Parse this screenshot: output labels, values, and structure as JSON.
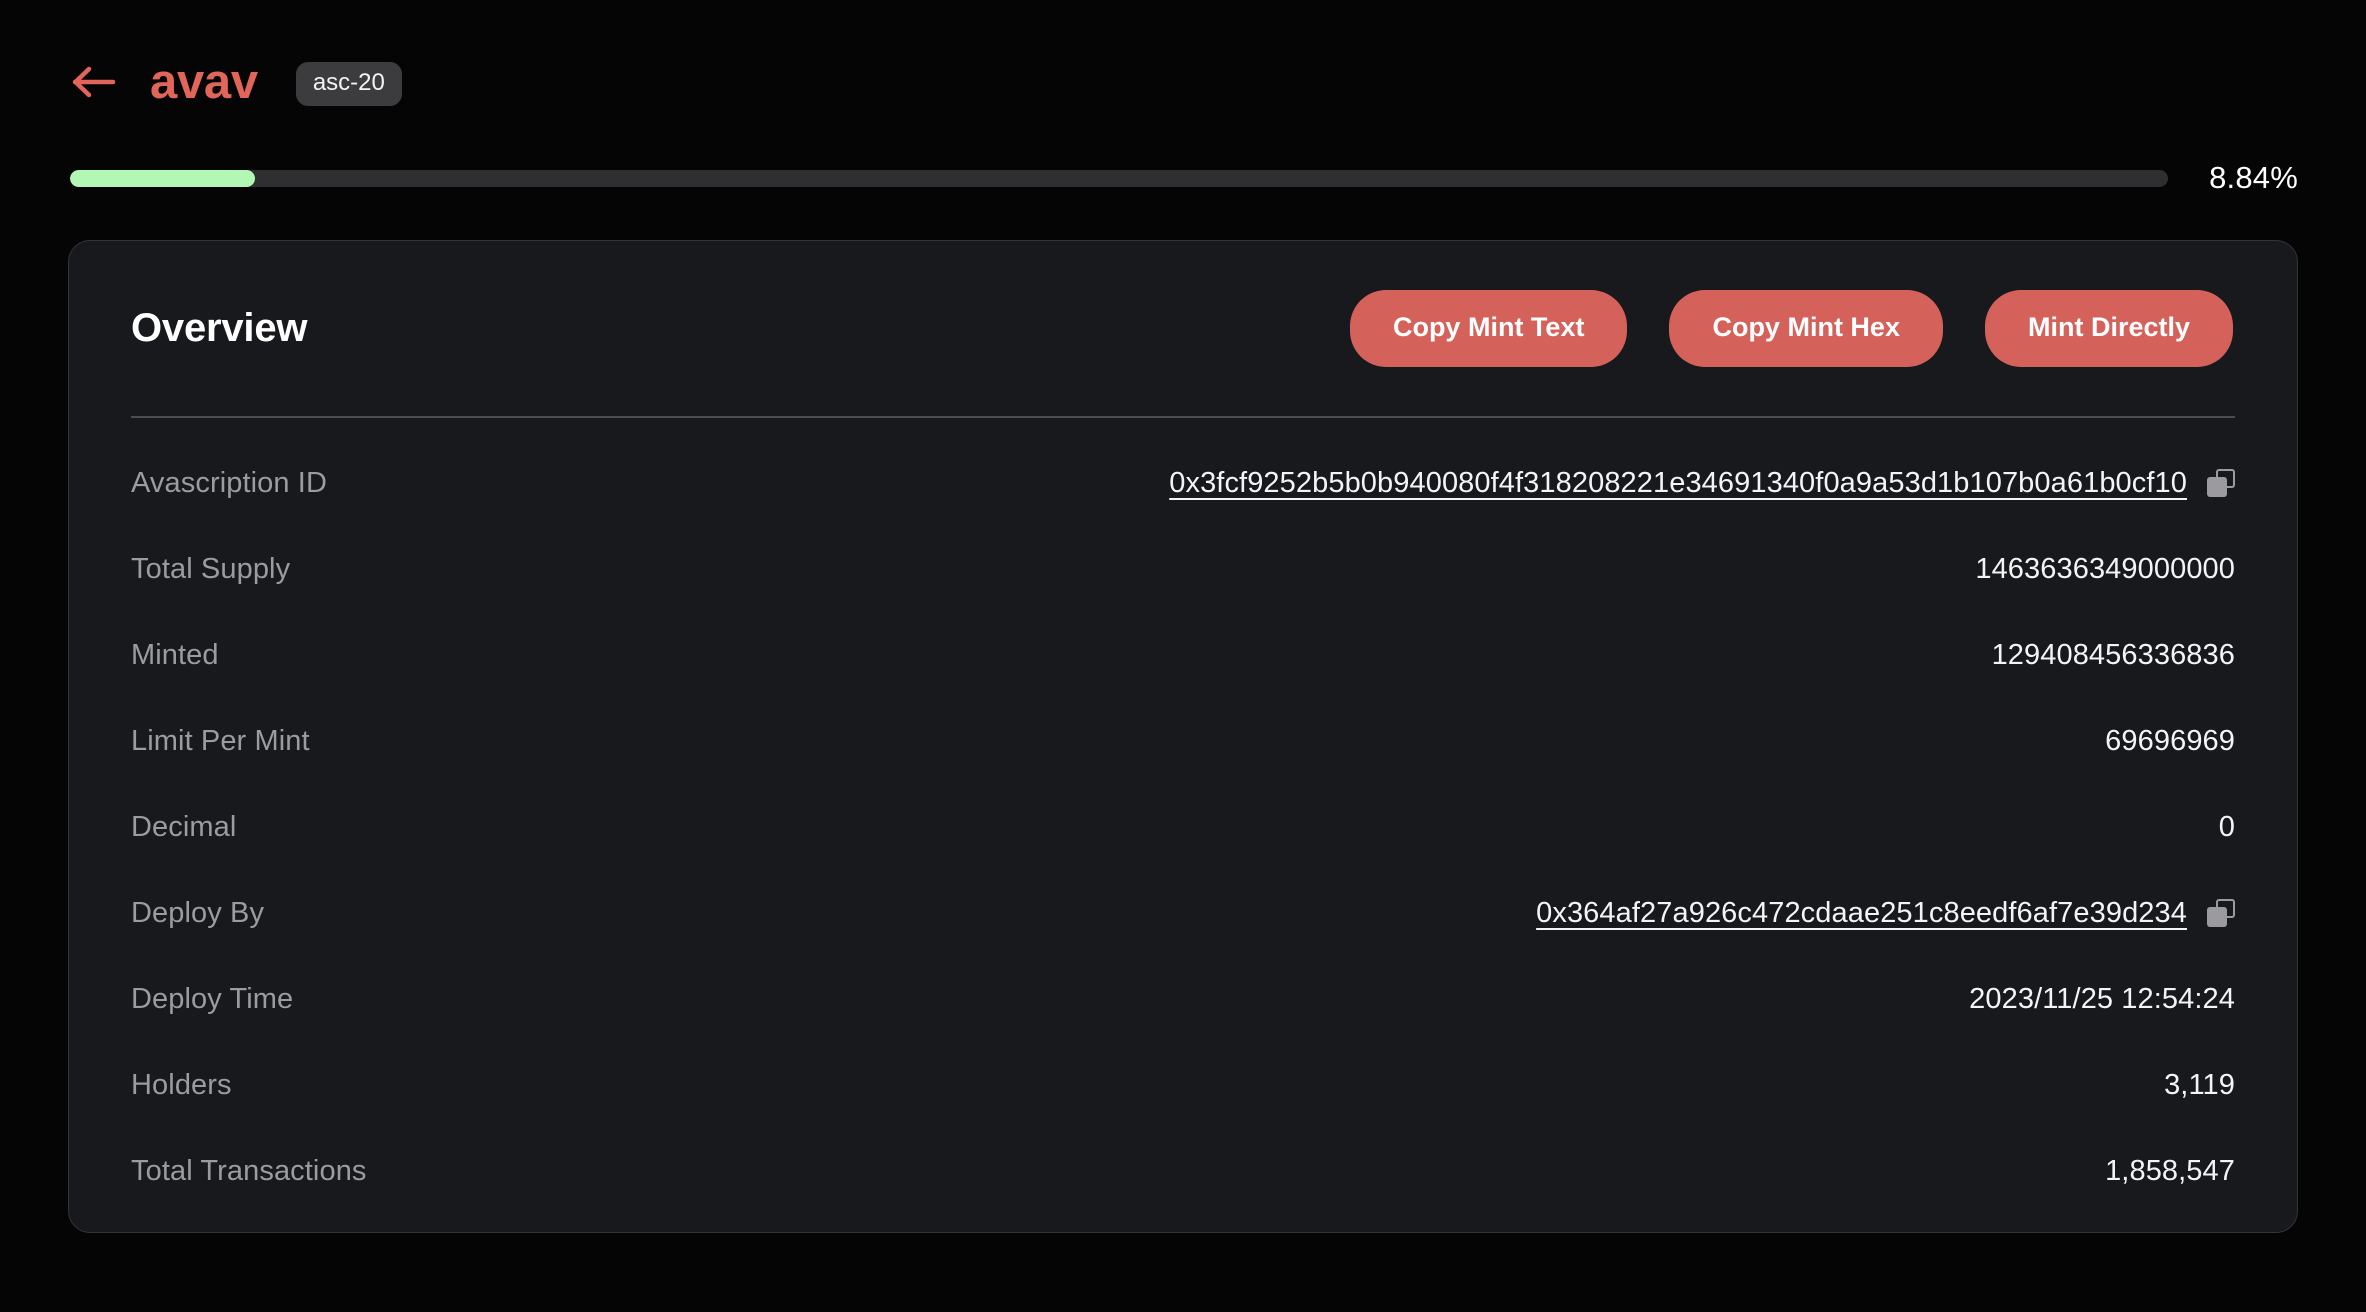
{
  "header": {
    "back_icon": "arrow-left-icon",
    "token_name": "avav",
    "protocol_badge": "asc-20",
    "accent_color": "#e2655a"
  },
  "progress": {
    "percent_label": "8.84%",
    "percent_value": 8.84,
    "fill_color": "#b2f7b4",
    "track_color": "#2f2f31"
  },
  "card": {
    "title": "Overview",
    "actions": [
      {
        "label": "Copy Mint Text",
        "name": "copy-mint-text-button"
      },
      {
        "label": "Copy Mint Hex",
        "name": "copy-mint-hex-button"
      },
      {
        "label": "Mint Directly",
        "name": "mint-directly-button"
      }
    ],
    "action_color": "#d5625a",
    "rows": [
      {
        "label": "Avascription ID",
        "value": "0x3fcf9252b5b0b940080f4f318208221e34691340f0a9a53d1b107b0a61b0cf10",
        "type": "link",
        "copyable": true
      },
      {
        "label": "Total Supply",
        "value": "1463636349000000",
        "type": "text",
        "copyable": false
      },
      {
        "label": "Minted",
        "value": "129408456336836",
        "type": "text",
        "copyable": false
      },
      {
        "label": "Limit Per Mint",
        "value": "69696969",
        "type": "text",
        "copyable": false
      },
      {
        "label": "Decimal",
        "value": "0",
        "type": "text",
        "copyable": false
      },
      {
        "label": "Deploy By",
        "value": "0x364af27a926c472cdaae251c8eedf6af7e39d234",
        "type": "link",
        "copyable": true
      },
      {
        "label": "Deploy Time",
        "value": "2023/11/25 12:54:24",
        "type": "text",
        "copyable": false
      },
      {
        "label": "Holders",
        "value": "3,119",
        "type": "text",
        "copyable": false
      },
      {
        "label": "Total Transactions",
        "value": "1,858,547",
        "type": "text",
        "copyable": false
      }
    ]
  }
}
